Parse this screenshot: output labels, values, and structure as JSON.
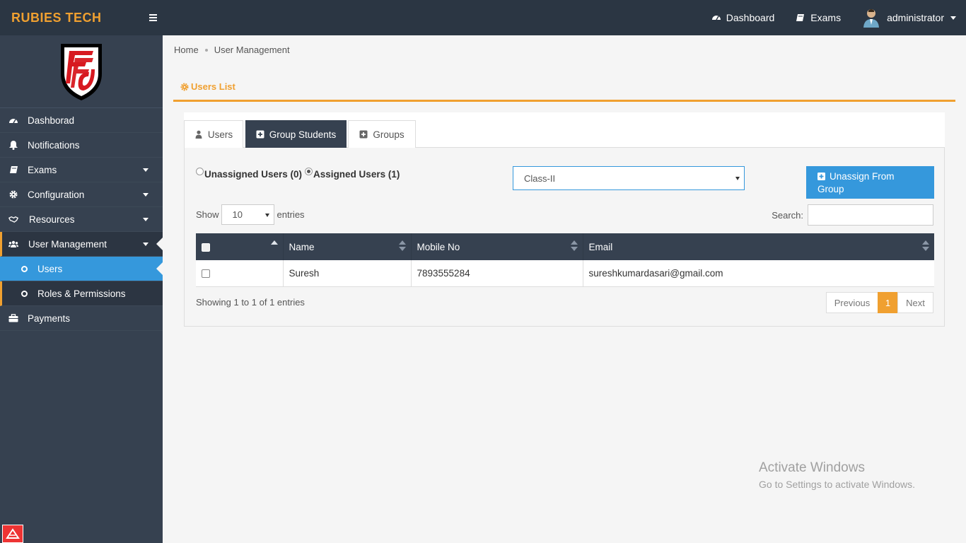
{
  "brand": {
    "name": "RUBIES TECH",
    "accent": "#f0a030"
  },
  "topnav": {
    "dashboard_label": "Dashboard",
    "exams_label": "Exams",
    "user_label": "administrator"
  },
  "sidebar": {
    "items": [
      {
        "label": "Dashborad",
        "icon": "dashboard-icon"
      },
      {
        "label": "Notifications",
        "icon": "bell-icon"
      },
      {
        "label": "Exams",
        "icon": "book-icon"
      },
      {
        "label": "Configuration",
        "icon": "gear-icon"
      },
      {
        "label": "Resources",
        "icon": "handshake-icon"
      },
      {
        "label": "User Management",
        "icon": "users-icon"
      },
      {
        "label": "Payments",
        "icon": "briefcase-icon"
      }
    ],
    "subitems": [
      {
        "label": "Users",
        "active": true
      },
      {
        "label": "Roles & Permissions",
        "active": false
      }
    ]
  },
  "breadcrumb": {
    "home": "Home",
    "current": "User Management"
  },
  "page": {
    "title": "Users List"
  },
  "tabs": [
    {
      "label": "Users",
      "icon": "user-icon"
    },
    {
      "label": "Group Students",
      "icon": "plus-square-icon",
      "active": true
    },
    {
      "label": "Groups",
      "icon": "plus-square-icon"
    }
  ],
  "filters": {
    "unassigned_label": "Unassigned Users (0)",
    "assigned_label": "Assigned Users (1)",
    "class_selected": "Class-II",
    "unassign_line1": "Unassign From",
    "unassign_line2": "Group"
  },
  "table_controls": {
    "show_label": "Show",
    "page_length": "10",
    "entries_label": "entries",
    "search_label": "Search:",
    "search_value": ""
  },
  "table": {
    "columns": [
      "Name",
      "Mobile No",
      "Email"
    ],
    "rows": [
      {
        "name": "Suresh",
        "mobile": "7893555284",
        "email": "sureshkumardasari@gmail.com"
      }
    ]
  },
  "pagination": {
    "info": "Showing 1 to 1 of 1 entries",
    "previous": "Previous",
    "current_page": "1",
    "next": "Next"
  },
  "watermark": {
    "line1": "Activate Windows",
    "line2": "Go to Settings to activate Windows."
  }
}
